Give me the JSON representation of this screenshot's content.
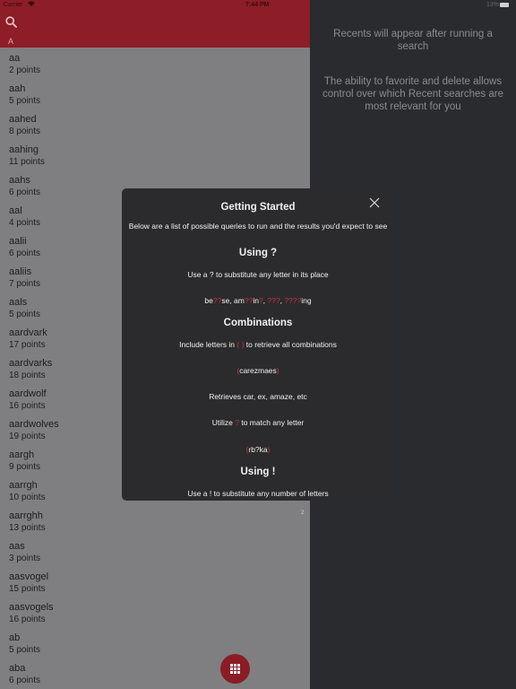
{
  "status_bar": {
    "carrier": "Carrier",
    "time": "7:44 PM",
    "battery": "13%"
  },
  "list": {
    "section_letter": "A",
    "items": [
      {
        "word": "aa",
        "points": "2 points"
      },
      {
        "word": "aah",
        "points": "5 points"
      },
      {
        "word": "aahed",
        "points": "8 points"
      },
      {
        "word": "aahing",
        "points": "11 points"
      },
      {
        "word": "aahs",
        "points": "6 points"
      },
      {
        "word": "aal",
        "points": "4 points"
      },
      {
        "word": "aalii",
        "points": "6 points"
      },
      {
        "word": "aaliis",
        "points": "7 points"
      },
      {
        "word": "aals",
        "points": "5 points"
      },
      {
        "word": "aardvark",
        "points": "17 points"
      },
      {
        "word": "aardvarks",
        "points": "18 points"
      },
      {
        "word": "aardwolf",
        "points": "16 points"
      },
      {
        "word": "aardwolves",
        "points": "19 points"
      },
      {
        "word": "aargh",
        "points": "9 points"
      },
      {
        "word": "aarrgh",
        "points": "10 points"
      },
      {
        "word": "aarrghh",
        "points": "13 points"
      },
      {
        "word": "aas",
        "points": "3 points"
      },
      {
        "word": "aasvogel",
        "points": "15 points"
      },
      {
        "word": "aasvogels",
        "points": "16 points"
      },
      {
        "word": "ab",
        "points": "5 points"
      },
      {
        "word": "aba",
        "points": "6 points"
      }
    ]
  },
  "recents": {
    "empty_hint": "Recents will appear after running a search",
    "favorite_hint": "The ability to favorite and delete allows control over which Recent searches are most relevant for you"
  },
  "modal": {
    "title": "Getting Started",
    "intro": "Below are a list of possible queries to run and the results you'd expect to see",
    "using_q_title": "Using ?",
    "using_q_desc": "Use a ? to substitute any letter in its place",
    "ex1_a": "be",
    "ex1_b": "??",
    "ex1_c": "se,   am",
    "ex1_d": "??",
    "ex1_e": "in",
    "ex1_f": "?",
    "ex1_g": ",   ",
    "ex1_h": "???",
    "ex1_i": ",   ",
    "ex1_j": "????",
    "ex1_k": "ing",
    "combinations_title": "Combinations",
    "comb_desc_a": "Include letters in ",
    "comb_desc_b": "( )",
    "comb_desc_c": " to retrieve all combinations",
    "comb_ex_open": "(",
    "comb_ex_word": "carezmaes",
    "comb_ex_close": ")",
    "comb_result": "Retrieves car, ex, amaze, etc",
    "util_a": "Utilize ",
    "util_b": "?",
    "util_c": " to match any letter",
    "util_ex_open": "(",
    "util_ex_word": "rb?ka",
    "util_ex_close": ")",
    "using_bang_title": "Using !",
    "using_bang_desc": "Use a ! to substitute any number of letters",
    "page_mark": "2"
  },
  "colors": {
    "accent": "#8d1d27",
    "highlight": "#c53340",
    "modal_bg": "#2b2b2d"
  }
}
